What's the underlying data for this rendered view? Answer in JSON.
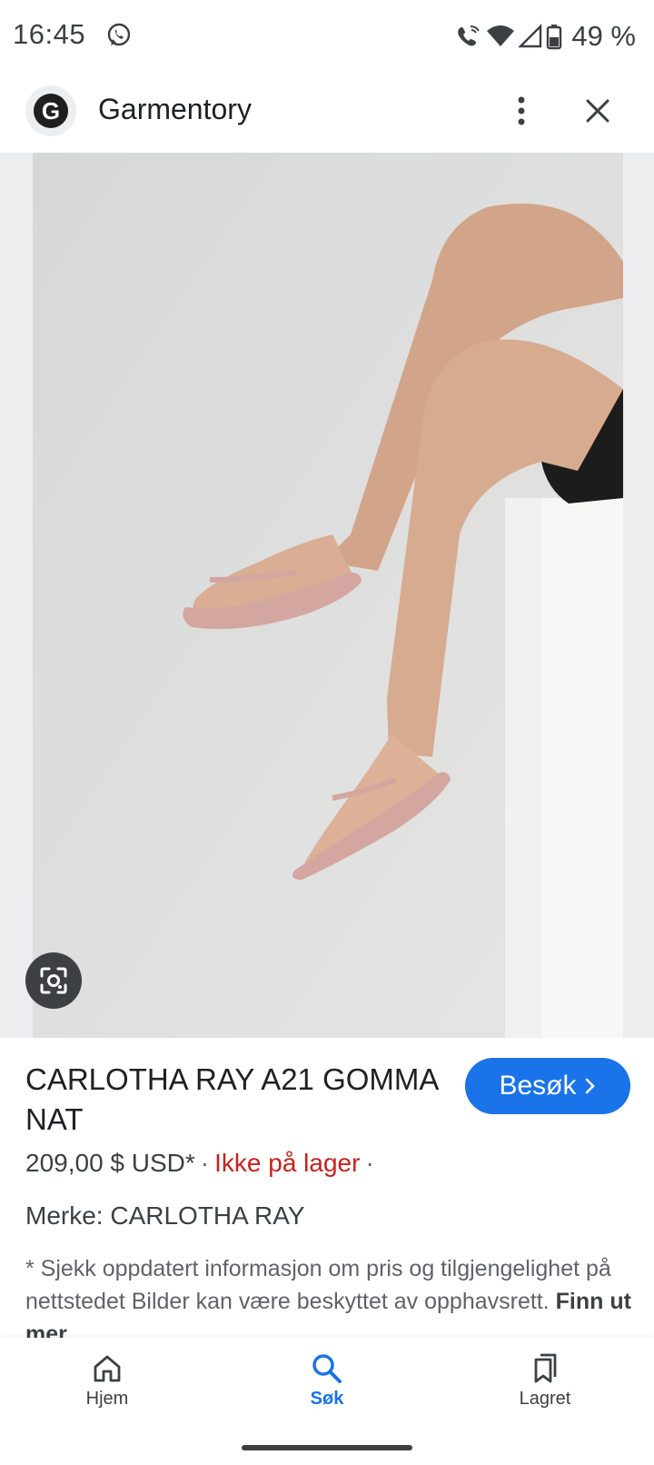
{
  "status_bar": {
    "time": "16:45",
    "battery": "49 %",
    "icons": [
      "whatsapp-icon",
      "wifi-call-icon",
      "wifi-icon",
      "signal-icon",
      "battery-icon"
    ]
  },
  "header": {
    "logo_letter": "G",
    "site_name": "Garmentory"
  },
  "product": {
    "title": "CARLOTHA RAY A21 GOMMA NAT",
    "visit_label": "Besøk",
    "price": "209,00 $ USD*",
    "stock": "Ikke på lager",
    "brand": "Merke: CARLOTHA RAY",
    "disclaimer": "* Sjekk oppdatert informasjon om pris og tilgjengelighet på nettstedet Bilder kan være beskyttet av opphavsrett.",
    "learn_more": "Finn ut mer"
  },
  "bottom_nav": {
    "items": [
      {
        "label": "Hjem",
        "icon": "home-icon"
      },
      {
        "label": "Søk",
        "icon": "search-icon"
      },
      {
        "label": "Lagret",
        "icon": "saved-icon"
      }
    ],
    "active_index": 1
  },
  "colors": {
    "accent": "#1a73e8",
    "out_of_stock": "#c5221f",
    "sandal": "#d4a6a0"
  }
}
